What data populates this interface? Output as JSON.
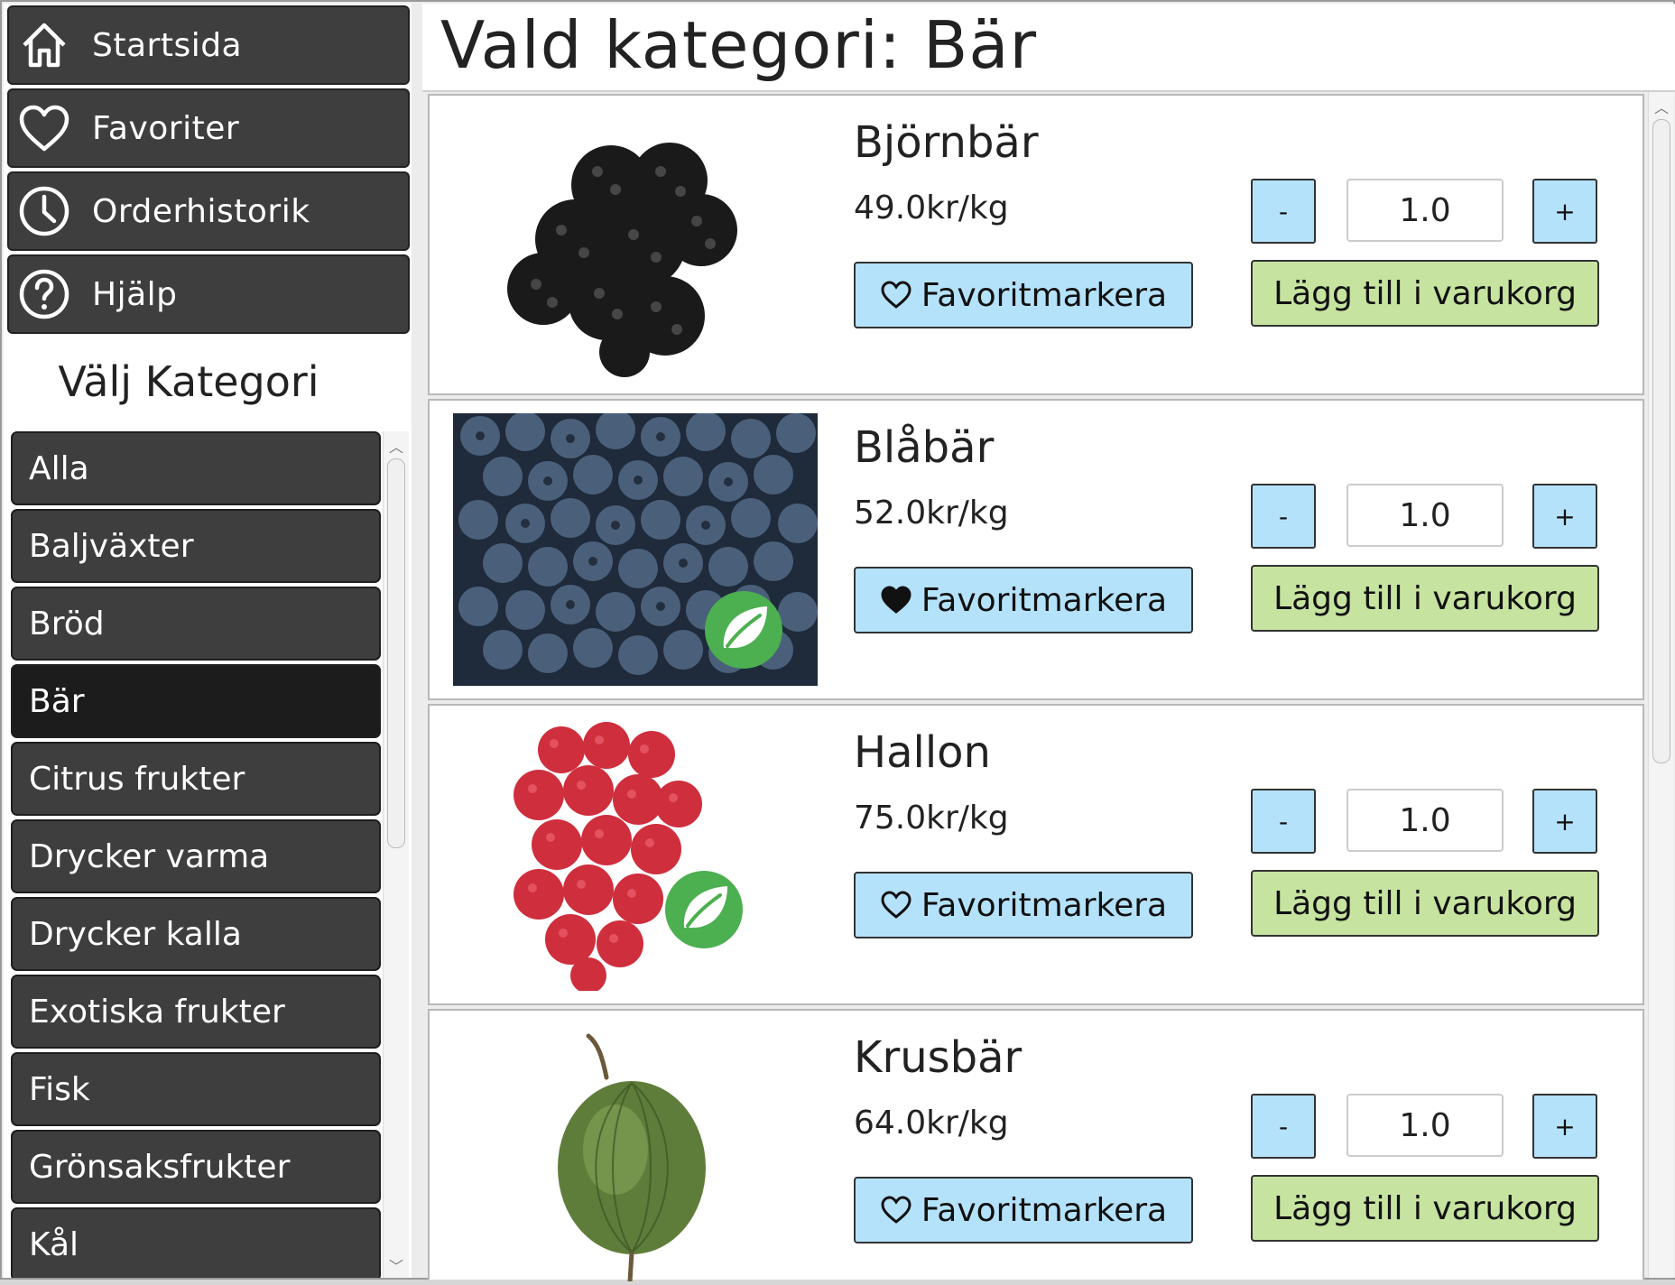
{
  "nav": [
    {
      "label": "Startsida",
      "icon": "home-icon"
    },
    {
      "label": "Favoriter",
      "icon": "heart-icon"
    },
    {
      "label": "Orderhistorik",
      "icon": "clock-icon"
    },
    {
      "label": "Hjälp",
      "icon": "help-icon"
    }
  ],
  "categories": {
    "title": "Välj Kategori",
    "items": [
      "Alla",
      "Baljväxter",
      "Bröd",
      "Bär",
      "Citrus frukter",
      "Drycker varma",
      "Drycker kalla",
      "Exotiska frukter",
      "Fisk",
      "Grönsaksfrukter",
      "Kål"
    ],
    "active": "Bär"
  },
  "main": {
    "heading": "Vald kategori: Bär"
  },
  "products": [
    {
      "name": "Björnbär",
      "price": "49.0kr/kg",
      "favorite_label": "Favoritmarkera",
      "favorited": false,
      "eco": false,
      "minus": "-",
      "qty": "1.0",
      "plus": "+",
      "add_label": "Lägg till i varukorg"
    },
    {
      "name": "Blåbär",
      "price": "52.0kr/kg",
      "favorite_label": "Favoritmarkera",
      "favorited": true,
      "eco": true,
      "minus": "-",
      "qty": "1.0",
      "plus": "+",
      "add_label": "Lägg till i varukorg"
    },
    {
      "name": "Hallon",
      "price": "75.0kr/kg",
      "favorite_label": "Favoritmarkera",
      "favorited": false,
      "eco": true,
      "minus": "-",
      "qty": "1.0",
      "plus": "+",
      "add_label": "Lägg till i varukorg"
    },
    {
      "name": "Krusbär",
      "price": "64.0kr/kg",
      "favorite_label": "Favoritmarkera",
      "favorited": false,
      "eco": false,
      "minus": "-",
      "qty": "1.0",
      "plus": "+",
      "add_label": "Lägg till i varukorg"
    }
  ],
  "colors": {
    "nav_bg": "#3e3e3e",
    "active_category": "#1c1c1c",
    "favorite_button": "#b4e2fb",
    "add_button": "#c6e3a0",
    "eco_badge": "#4caf50"
  }
}
